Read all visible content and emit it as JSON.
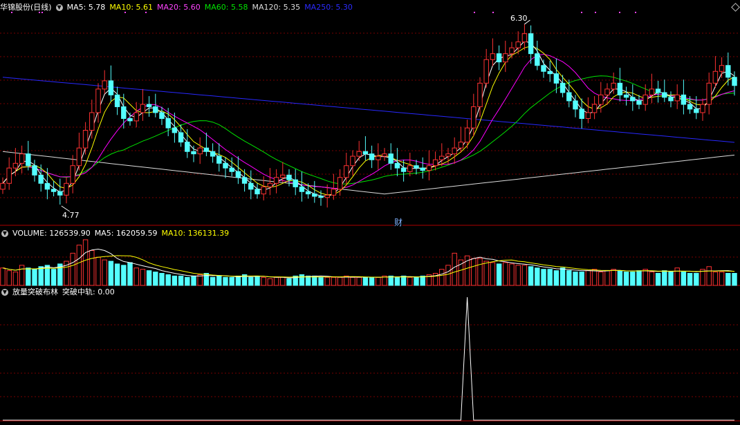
{
  "colors": {
    "up": "#ff3232",
    "down": "#54ffff",
    "ma5": "#ffffff",
    "ma10": "#ffff00",
    "ma20": "#ff00ff",
    "ma60": "#00e400",
    "ma120": "#dddddd",
    "ma250": "#2828ff",
    "grid": "#7a0000",
    "peak": "#ffffff"
  },
  "panel1": {
    "stock": "华锦股份(日线)",
    "ma5": "MA5: 5.78",
    "ma10": "MA10: 5.61",
    "ma20": "MA20: 5.60",
    "ma60": "MA60: 5.58",
    "ma120": "MA120: 5.35",
    "ma250": "MA250: 5.30",
    "high_label": "6.30",
    "low_label": "4.77",
    "event_label": "财"
  },
  "panel2": {
    "volume": "VOLUME: 126539.90",
    "ma5": "MA5: 162059.59",
    "ma10": "MA10: 136131.39"
  },
  "panel3": {
    "title": "放量突破布林",
    "mid": "突破中轨: 0.00"
  },
  "icons": {
    "legend_toggle": "chevron-down-icon",
    "corner": "diamond-icon"
  },
  "chart_data": [
    {
      "type": "candlestick",
      "name": "price",
      "ylim": [
        4.6,
        6.4
      ],
      "high": 6.3,
      "low": 4.77,
      "closes": [
        4.95,
        5.08,
        5.12,
        5.2,
        5.1,
        5.02,
        4.95,
        4.9,
        4.88,
        4.85,
        4.95,
        5.1,
        5.25,
        5.4,
        5.55,
        5.75,
        5.82,
        5.7,
        5.6,
        5.5,
        5.48,
        5.55,
        5.62,
        5.6,
        5.55,
        5.5,
        5.42,
        5.38,
        5.3,
        5.22,
        5.2,
        5.25,
        5.22,
        5.18,
        5.12,
        5.08,
        5.05,
        5.0,
        4.95,
        4.9,
        4.86,
        4.92,
        4.95,
        5.0,
        5.02,
        4.98,
        4.92,
        4.88,
        4.86,
        4.84,
        4.83,
        4.85,
        4.9,
        5.0,
        5.1,
        5.18,
        5.22,
        5.2,
        5.15,
        5.18,
        5.2,
        5.12,
        5.08,
        5.05,
        5.1,
        5.08,
        5.06,
        5.1,
        5.15,
        5.18,
        5.2,
        5.25,
        5.3,
        5.42,
        5.6,
        5.8,
        6.0,
        6.05,
        5.98,
        6.05,
        6.1,
        6.15,
        6.22,
        6.05,
        5.95,
        5.9,
        5.88,
        5.8,
        5.72,
        5.65,
        5.58,
        5.5,
        5.55,
        5.62,
        5.7,
        5.75,
        5.8,
        5.7,
        5.68,
        5.65,
        5.62,
        5.7,
        5.75,
        5.72,
        5.68,
        5.65,
        5.7,
        5.62,
        5.58,
        5.55,
        5.62,
        5.8,
        5.9,
        5.95,
        5.85,
        5.78
      ]
    },
    {
      "type": "bar",
      "name": "volume",
      "values": [
        1.3,
        1.1,
        1.0,
        1.5,
        1.3,
        1.2,
        1.4,
        1.5,
        1.2,
        1.6,
        1.8,
        2.4,
        3.0,
        3.4,
        2.6,
        2.1,
        1.9,
        1.8,
        1.6,
        1.5,
        1.7,
        1.3,
        1.2,
        1.1,
        1.0,
        0.9,
        0.8,
        0.7,
        0.7,
        0.6,
        0.7,
        0.8,
        0.9,
        0.6,
        0.7,
        0.6,
        0.6,
        0.7,
        0.8,
        0.6,
        0.7,
        0.6,
        0.5,
        0.6,
        0.6,
        0.5,
        0.7,
        0.8,
        0.7,
        0.7,
        0.6,
        0.6,
        0.6,
        0.6,
        0.7,
        0.6,
        0.6,
        0.6,
        0.6,
        0.6,
        0.7,
        0.7,
        0.6,
        0.7,
        0.6,
        0.6,
        0.7,
        0.8,
        0.9,
        1.2,
        1.5,
        2.4,
        1.9,
        2.2,
        2.0,
        2.0,
        1.8,
        1.7,
        1.6,
        1.7,
        1.6,
        1.5,
        1.5,
        1.4,
        1.3,
        1.2,
        1.2,
        1.1,
        1.3,
        1.1,
        1.0,
        1.0,
        1.1,
        1.2,
        1.0,
        1.1,
        1.2,
        1.1,
        1.0,
        1.0,
        1.1,
        1.2,
        1.0,
        0.9,
        1.1,
        1.0,
        1.3,
        1.0,
        0.9,
        0.9,
        1.2,
        1.4,
        1.0,
        1.0,
        0.9,
        0.9
      ]
    },
    {
      "type": "line",
      "name": "breakout",
      "values": [
        0,
        0,
        0,
        0,
        0,
        0,
        0,
        0,
        0,
        0,
        0,
        0,
        0,
        0,
        0,
        0,
        0,
        0,
        0,
        0,
        0,
        0,
        0,
        0,
        0,
        0,
        0,
        0,
        0,
        0,
        0,
        0,
        0,
        0,
        0,
        0,
        0,
        0,
        0,
        0,
        0,
        0,
        0,
        0,
        0,
        0,
        0,
        0,
        0,
        0,
        0,
        0,
        0,
        0,
        0,
        0,
        0,
        0,
        0,
        0,
        0,
        0,
        0,
        0,
        0,
        0,
        0,
        0,
        0,
        0,
        0,
        0,
        0,
        1,
        0,
        0,
        0,
        0,
        0,
        0,
        0,
        0,
        0,
        0,
        0,
        0,
        0,
        0,
        0,
        0,
        0,
        0,
        0,
        0,
        0,
        0,
        0,
        0,
        0,
        0,
        0,
        0,
        0,
        0,
        0,
        0,
        0,
        0,
        0,
        0,
        0,
        0,
        0,
        0,
        0,
        0
      ]
    }
  ]
}
